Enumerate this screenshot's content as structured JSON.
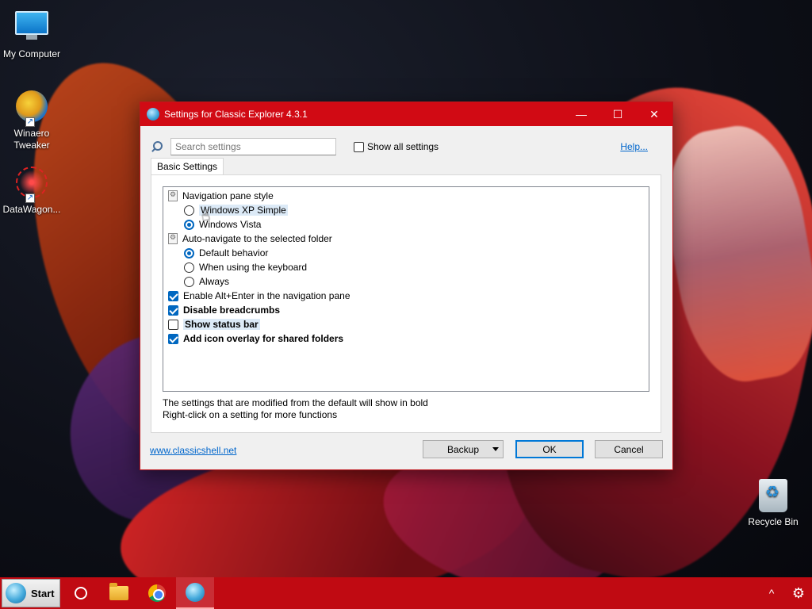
{
  "desktop": {
    "icons": [
      {
        "label": "My Computer"
      },
      {
        "label": "Winaero Tweaker"
      },
      {
        "label": "DataWagon..."
      },
      {
        "label": "Recycle Bin"
      }
    ]
  },
  "window": {
    "title": "Settings for Classic Explorer 4.3.1",
    "controls": {
      "minimize": "—",
      "maximize": "☐",
      "close": "✕"
    },
    "search": {
      "placeholder": "Search settings",
      "value": ""
    },
    "show_all": {
      "label": "Show all settings",
      "checked": false
    },
    "help_label": "Help...",
    "tab_label": "Basic Settings",
    "settings": [
      {
        "kind": "group",
        "label": "Navigation pane style"
      },
      {
        "kind": "radio",
        "label": "Windows XP Simple",
        "selected": false
      },
      {
        "kind": "radio",
        "label": "Windows Vista",
        "selected": true
      },
      {
        "kind": "group",
        "label": "Auto-navigate to the selected folder"
      },
      {
        "kind": "radio",
        "label": "Default behavior",
        "selected": true
      },
      {
        "kind": "radio",
        "label": "When using the keyboard",
        "selected": false
      },
      {
        "kind": "radio",
        "label": "Always",
        "selected": false
      },
      {
        "kind": "check",
        "label": "Enable Alt+Enter in the navigation pane",
        "checked": true,
        "bold": false
      },
      {
        "kind": "check",
        "label": "Disable breadcrumbs",
        "checked": true,
        "bold": true
      },
      {
        "kind": "check",
        "label": "Show status bar",
        "checked": false,
        "bold": true
      },
      {
        "kind": "check",
        "label": "Add icon overlay for shared folders",
        "checked": true,
        "bold": true
      }
    ],
    "info_line1": "The settings that are modified from the default will show in bold",
    "info_line2": "Right-click on a setting for more functions",
    "site_link": "www.classicshell.net",
    "backup_label": "Backup",
    "ok_label": "OK",
    "cancel_label": "Cancel"
  },
  "taskbar": {
    "start_label": "Start",
    "tray_chevron": "^",
    "tray_gear": "⚙"
  },
  "colors": {
    "title_bar": "#d10a14",
    "taskbar": "#c00a12",
    "accent": "#0067c0",
    "link": "#0066cc"
  }
}
